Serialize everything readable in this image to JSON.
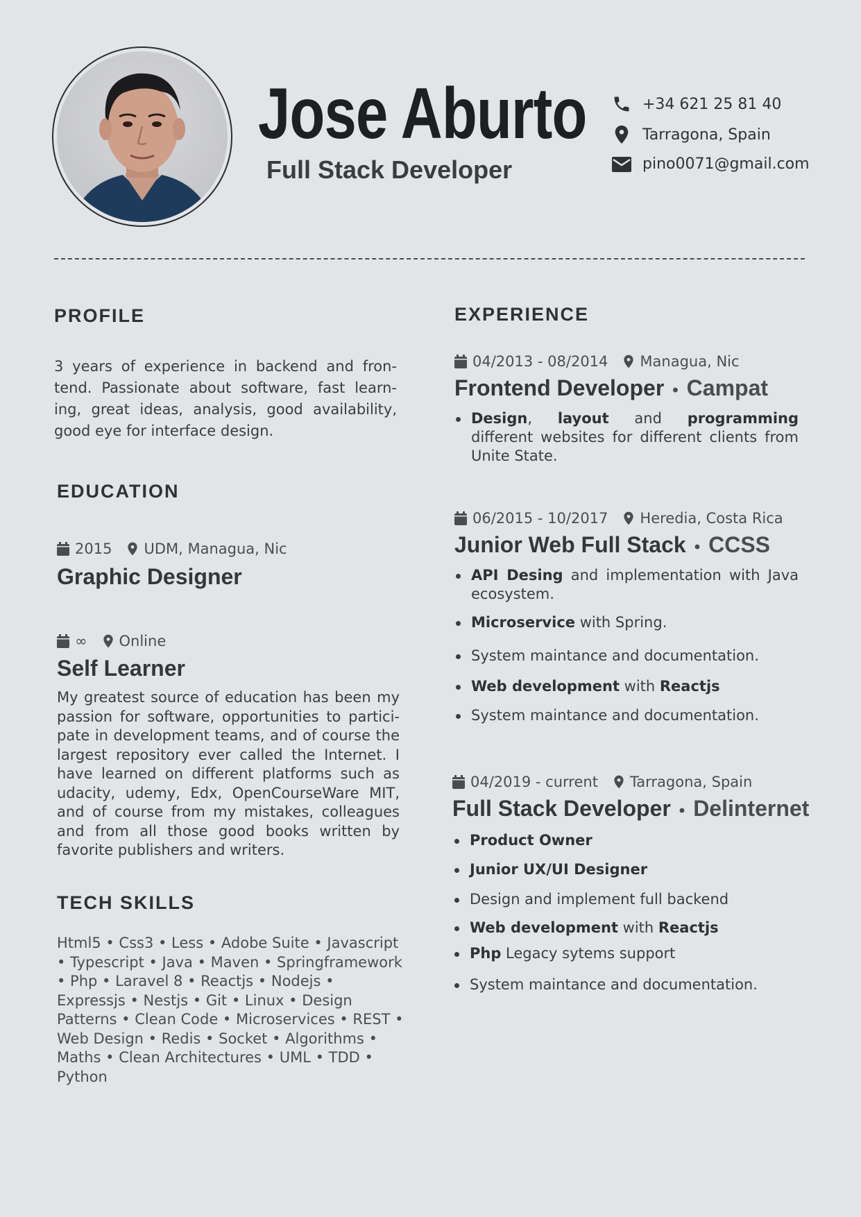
{
  "header": {
    "name": "Jose Aburto",
    "role": "Full Stack Developer",
    "contacts": {
      "phone": "+34 621 25 81 40",
      "location": "Tarragona, Spain",
      "email": "pino0071@gmail.com"
    }
  },
  "profile": {
    "heading": "PROFILE",
    "text": "3 years of experience in backend and fron- tend. Passionate about software, fast learn- ing, great ideas, analysis, good availability, good eye for interface design."
  },
  "education": {
    "heading": "EDUCATION",
    "items": [
      {
        "date": "2015",
        "place": "UDM, Managua, Nic",
        "title": "Graphic Designer"
      },
      {
        "date": "∞",
        "place": "Online",
        "title": "Self Learner",
        "text": "My greatest source of education has been my passion for software, opportunities to partici- pate in development teams, and of course the largest repository ever called the Internet. I have learned on different platforms such as udacity, udemy, Edx, OpenCourseWare MIT, and of course from my mistakes, colleagues and from all those good books written by favorite publishers and writers."
      }
    ]
  },
  "tech_skills": {
    "heading": "TECH SKILLS",
    "text": "Html5 • Css3 • Less • Adobe Suite • Javascript • Typescript • Java • Maven • Springframework • Php • Laravel 8 • Reactjs • Nodejs • Expressjs • Nestjs • Git • Linux • Design Patterns • Clean Code • Microservices • REST • Web Design • Redis • Socket • Algorithms • Maths • Clean Architectures • UML • TDD • Python"
  },
  "experience": {
    "heading": "EXPERIENCE",
    "jobs": [
      {
        "date": "04/2013 - 08/2014",
        "place": "Managua, Nic",
        "title": "Frontend Developer",
        "company": "Campat",
        "b1": {
          "s1": "Design",
          "t1": ", ",
          "s2": "layout",
          "t2": " and ",
          "s3": "programming",
          "t3": " different websites for different clients from Unite State."
        }
      },
      {
        "date": "06/2015 - 10/2017",
        "place": "Heredia, Costa Rica",
        "title": "Junior Web Full Stack",
        "company": "CCSS",
        "b1": {
          "s": "API Desing",
          "t": " and implementation with Java ecosystem."
        },
        "b2": {
          "s": "Microservice",
          "t": " with Spring."
        },
        "b3": "System maintance and documentation.",
        "b4": {
          "s1": "Web development",
          "t": " with ",
          "s2": "Reactjs"
        },
        "b5": "System maintance and documentation."
      },
      {
        "date": "04/2019 - current",
        "place": "Tarragona, Spain",
        "title": "Full Stack Developer",
        "company": "Delinternet",
        "b1": "Product Owner",
        "b2": "Junior UX/UI Designer",
        "b3": "Design and implement full backend",
        "b4": {
          "s1": "Web development",
          "t": " with ",
          "s2": "Reactjs"
        },
        "b5": {
          "s": "Php",
          "t": " Legacy sytems support"
        },
        "b6": "System maintance and documentation."
      }
    ]
  },
  "icons": {
    "phone": "phone-icon",
    "location": "map-pin-icon",
    "email": "envelope-icon",
    "date": "calendar-icon"
  },
  "colors": {
    "background": "#e3e4e8",
    "text_dark": "#1e1f21",
    "text": "#3a3d40"
  }
}
